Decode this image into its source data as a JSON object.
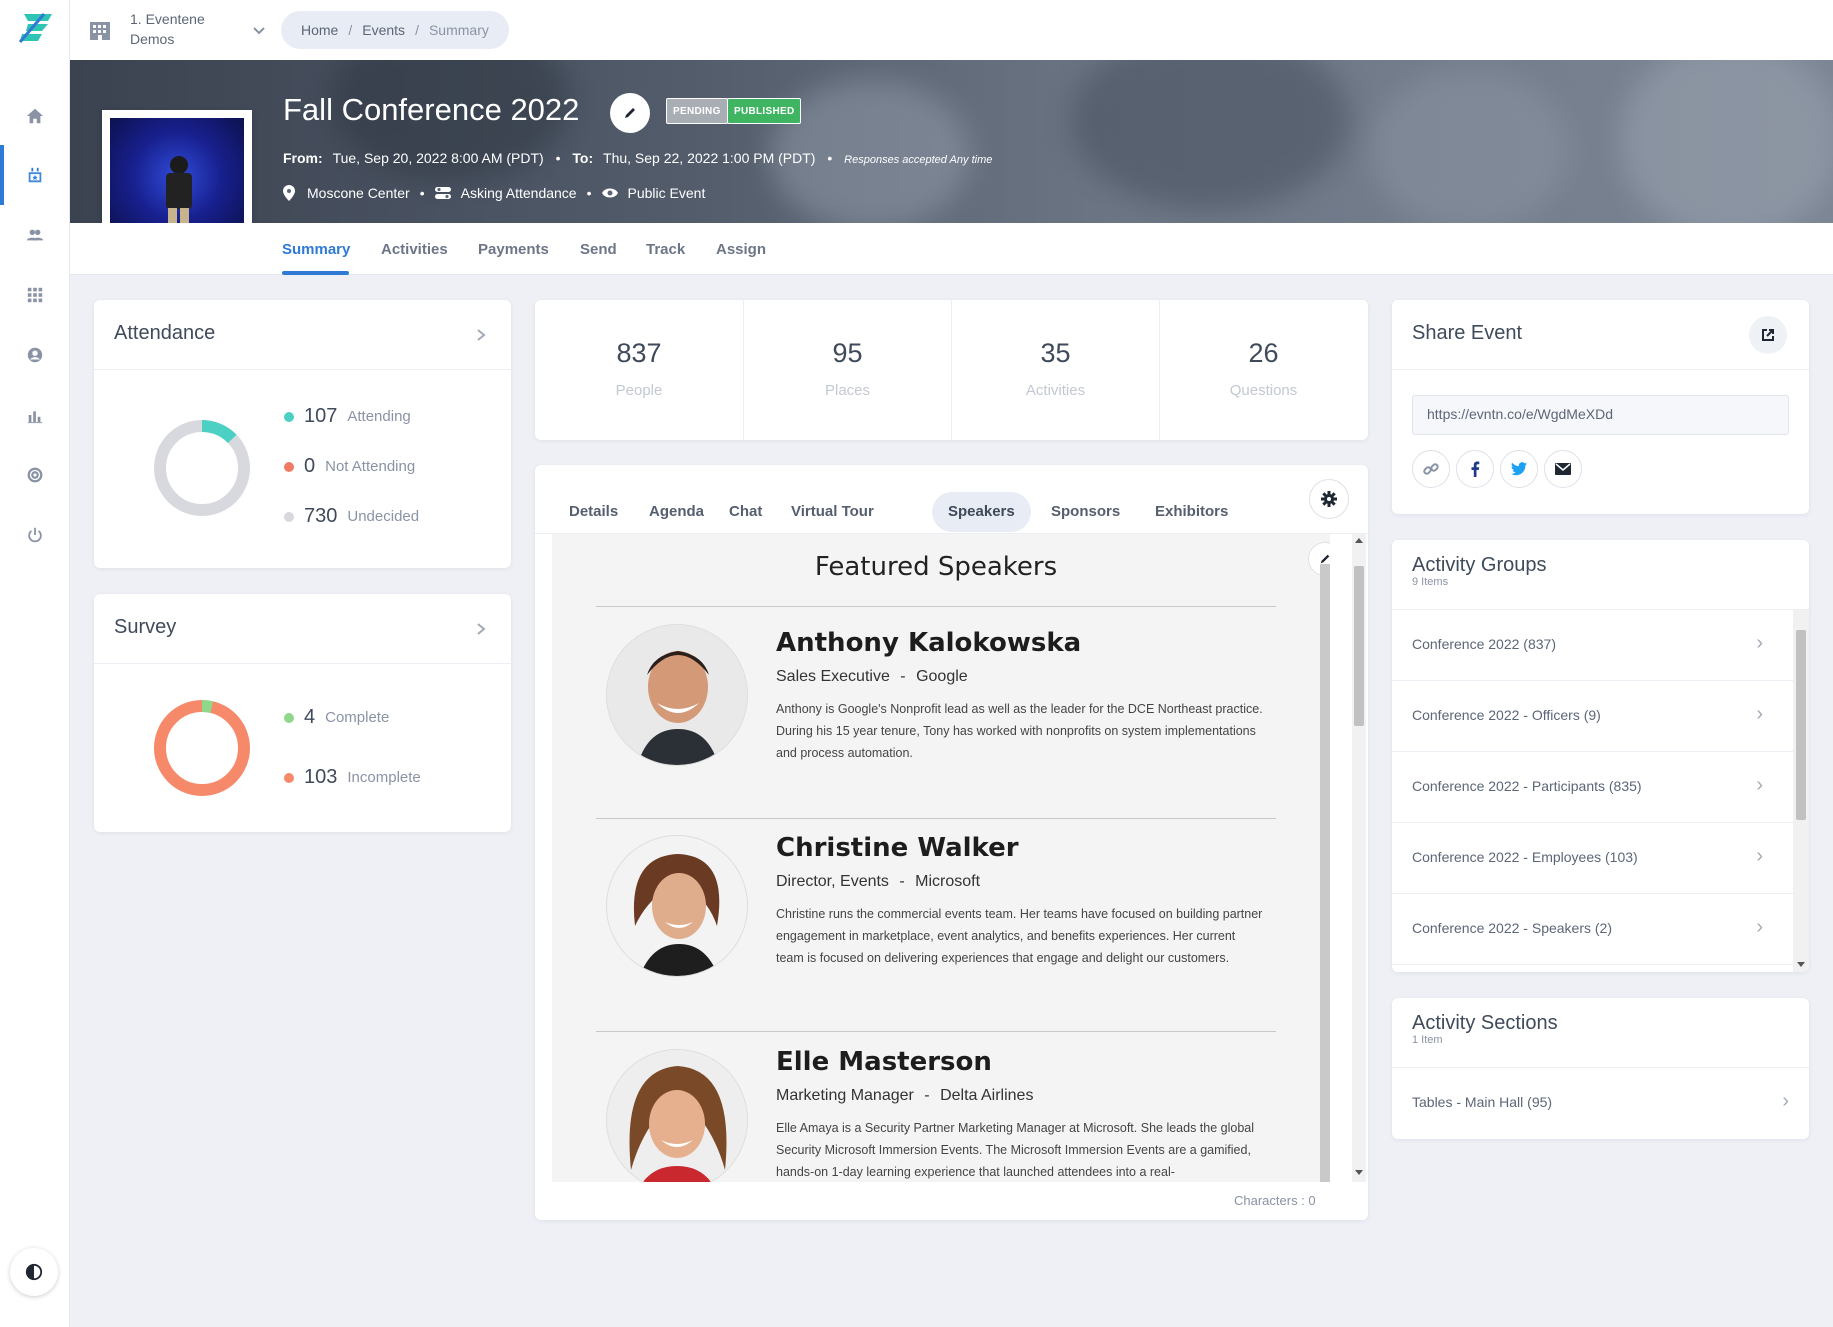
{
  "org": {
    "name_line1": "1. Eventene",
    "name_line2": "Demos"
  },
  "breadcrumb": {
    "home": "Home",
    "events": "Events",
    "current": "Summary",
    "sep": "/"
  },
  "event": {
    "title": "Fall Conference 2022",
    "badge_pending": "PENDING",
    "badge_published": "PUBLISHED",
    "from_label": "From:",
    "from_value": "Tue, Sep 20, 2022 8:00 AM (PDT)",
    "to_label": "To:",
    "to_value": "Thu, Sep 22, 2022 1:00 PM (PDT)",
    "responses_note": "Responses accepted Any time",
    "location": "Moscone Center",
    "attendance_mode": "Asking Attendance",
    "visibility": "Public Event",
    "bullet": "•"
  },
  "sub_tabs": [
    "Summary",
    "Activities",
    "Payments",
    "Send",
    "Track",
    "Assign"
  ],
  "attendance": {
    "title": "Attendance",
    "attending": {
      "value": "107",
      "label": "Attending",
      "color": "#4dd0c4"
    },
    "not_attending": {
      "value": "0",
      "label": "Not Attending",
      "color": "#f07b63"
    },
    "undecided": {
      "value": "730",
      "label": "Undecided",
      "color": "#d7d9de"
    }
  },
  "survey": {
    "title": "Survey",
    "complete": {
      "value": "4",
      "label": "Complete",
      "color": "#8fd88a"
    },
    "incomplete": {
      "value": "103",
      "label": "Incomplete",
      "color": "#f5896a"
    }
  },
  "stats": [
    {
      "value": "837",
      "label": "People"
    },
    {
      "value": "95",
      "label": "Places"
    },
    {
      "value": "35",
      "label": "Activities"
    },
    {
      "value": "26",
      "label": "Questions"
    }
  ],
  "content_tabs": [
    "Details",
    "Agenda",
    "Chat",
    "Virtual Tour",
    "Speakers",
    "Sponsors",
    "Exhibitors"
  ],
  "content_tabs_active": "Speakers",
  "featured": {
    "heading": "Featured Speakers",
    "speakers": [
      {
        "name": "Anthony Kalokowska",
        "role": "Sales Executive",
        "company": "Google",
        "role_sep": "-",
        "bio": "Anthony is Google's Nonprofit lead as well as the leader for the DCE Northeast practice. During his 15 year tenure, Tony has worked with nonprofits on system implementations and process automation."
      },
      {
        "name": "Christine Walker",
        "role": "Director, Events",
        "company": "Microsoft",
        "role_sep": "-",
        "bio": "Christine runs the commercial events team. Her teams have focused on building partner engagement in marketplace, event analytics, and benefits experiences. Her current team is focused on delivering experiences that engage and delight our customers."
      },
      {
        "name": "Elle Masterson",
        "role": "Marketing Manager",
        "company": "Delta Airlines",
        "role_sep": "-",
        "bio": "Elle Amaya is a Security Partner Marketing Manager at Microsoft. She leads the global Security Microsoft Immersion Events. The Microsoft Immersion Events are a gamified, hands-on 1-day learning experience that launched attendees into a real-"
      }
    ],
    "characters": "Characters : 0"
  },
  "share": {
    "title": "Share Event",
    "url": "https://evntn.co/e/WgdMeXDd"
  },
  "activity_groups": {
    "title": "Activity Groups",
    "count": "9 Items",
    "items": [
      "Conference 2022 (837)",
      "Conference 2022 - Officers (9)",
      "Conference 2022 - Participants (835)",
      "Conference 2022 - Employees (103)",
      "Conference 2022 - Speakers (2)"
    ]
  },
  "activity_sections": {
    "title": "Activity Sections",
    "count": "1 Item",
    "items": [
      "Tables - Main Hall (95)"
    ]
  },
  "colors": {
    "accent": "#2f7ad5",
    "pending": "#a9adb4",
    "published": "#3fb562"
  }
}
